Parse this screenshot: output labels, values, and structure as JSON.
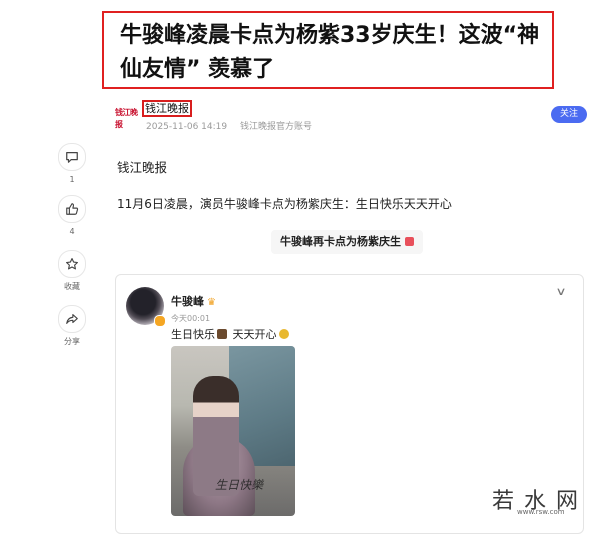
{
  "article": {
    "title": "牛骏峰凌晨卡点为杨紫33岁庆生！这波“神仙友情” 羡慕了",
    "source_logo": "钱江晚报",
    "source_name": "钱江晚报",
    "publish_time": "2025-11-06 14:19",
    "source_desc": "钱江晚报官方账号",
    "follow_label": "关注",
    "body_source": "钱江晚报",
    "body_paragraph": "11月6日凌晨，演员牛骏峰卡点为杨紫庆生：生日快乐天天开心",
    "topic_chip": "牛骏峰再卡点为杨紫庆生"
  },
  "actions": [
    {
      "icon": "comment-icon",
      "count": "1"
    },
    {
      "icon": "thumbs-up-icon",
      "count": "4"
    },
    {
      "icon": "star-icon",
      "count": "收藏"
    },
    {
      "icon": "share-icon",
      "count": "分享"
    }
  ],
  "post": {
    "author": "牛骏峰",
    "time": "今天00:01",
    "text_before": "生日快乐",
    "text_after": "天天开心",
    "image_caption": "生日快樂"
  },
  "watermark": {
    "text": "若水网",
    "url": "www.rsw.com"
  },
  "colors": {
    "highlight_border": "#e02020",
    "follow_button": "#4b6bf1"
  }
}
